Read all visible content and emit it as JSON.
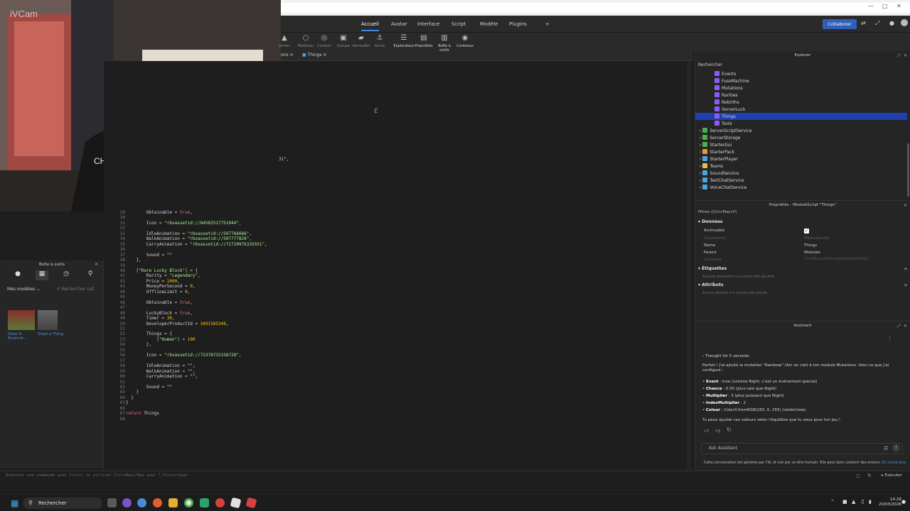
{
  "webcam": {
    "overlay_text": "iVCam",
    "shirt_text": "CHILL·GANG"
  },
  "menu": {
    "tabs": [
      "Accueil",
      "Avatar",
      "Interface",
      "Script",
      "Modèle",
      "Plugins",
      "+"
    ],
    "active": "Accueil",
    "collab_label": "Collaborer"
  },
  "ribbon": {
    "items": [
      {
        "label": "Matériau",
        "icon": "○"
      },
      {
        "label": "Couleur",
        "icon": "◎"
      },
      {
        "label": "Groupe",
        "icon": "▣"
      },
      {
        "label": "Verrouiller",
        "icon": "▰"
      },
      {
        "label": "Ancre",
        "icon": "⚓"
      },
      {
        "label": "Explorateur",
        "icon": "☰"
      },
      {
        "label": "Propriétés",
        "icon": "▤"
      },
      {
        "label": "Boîte à outils",
        "icon": "▥"
      },
      {
        "label": "Contenus",
        "icon": "◉"
      }
    ],
    "partial_label": "porter"
  },
  "tabs": {
    "first": "ons",
    "second": "Things"
  },
  "code": {
    "line_numbers": [
      "29",
      "30",
      "31",
      "32",
      "33",
      "34",
      "35",
      "36",
      "37",
      "38",
      "39",
      "40",
      "41",
      "42",
      "43",
      "44",
      "45",
      "46",
      "47",
      "48",
      "49",
      "50",
      "51",
      "52",
      "53",
      "54",
      "55",
      "56",
      "57",
      "58",
      "59",
      "60",
      "61",
      "62",
      "63",
      "64",
      "65",
      "66",
      "67",
      "68"
    ],
    "fragment": "31\","
  },
  "toolbox": {
    "title": "Boîte à outils",
    "dropdown": "Mes modèles",
    "search_placeholder": "Rechercher (utl",
    "models": [
      {
        "name": "Steal A Brainrot..."
      },
      {
        "name": "Steal a Thing"
      }
    ]
  },
  "command_bar": {
    "placeholder": "Exécuter une commande avec Ctrl+) ou utiliser Ctrl+Haut/Bas pour l'historique",
    "run_label": "Exécuter"
  },
  "explorer": {
    "title": "Explorer",
    "search_placeholder": "Rechercher",
    "items": [
      {
        "name": "Events",
        "indent": 2,
        "color": "#8a5cf6"
      },
      {
        "name": "FuseMachine",
        "indent": 2,
        "color": "#8a5cf6"
      },
      {
        "name": "Mutations",
        "indent": 2,
        "color": "#8a5cf6"
      },
      {
        "name": "Rarities",
        "indent": 2,
        "color": "#8a5cf6"
      },
      {
        "name": "Rebirths",
        "indent": 2,
        "color": "#8a5cf6"
      },
      {
        "name": "ServerLuck",
        "indent": 2,
        "color": "#8a5cf6"
      },
      {
        "name": "Things",
        "indent": 2,
        "color": "#8a5cf6",
        "selected": true
      },
      {
        "name": "Tools",
        "indent": 2,
        "color": "#8a5cf6"
      },
      {
        "name": "ServerScriptService",
        "indent": 0,
        "color": "#4caf50"
      },
      {
        "name": "ServerStorage",
        "indent": 0,
        "color": "#4caf50"
      },
      {
        "name": "StarterGui",
        "indent": 0,
        "color": "#4caf50"
      },
      {
        "name": "StarterPack",
        "indent": 0,
        "color": "#e39b38"
      },
      {
        "name": "StarterPlayer",
        "indent": 0,
        "color": "#4fa3e0"
      },
      {
        "name": "Teams",
        "indent": 0,
        "color": "#e0c04f"
      },
      {
        "name": "SoundService",
        "indent": 0,
        "color": "#4fa3e0"
      },
      {
        "name": "TextChatService",
        "indent": 0,
        "color": "#4fa3e0"
      },
      {
        "name": "VoiceChatService",
        "indent": 0,
        "color": "#4fa3e0"
      }
    ]
  },
  "properties": {
    "title": "Propriétés - ModuleScript \"Things\"",
    "filter_placeholder": "Filtres (Ctrl+Maj+P)",
    "sections": {
      "data": "Données",
      "tags": "Étiquettes",
      "attributes": "Attributs"
    },
    "rows": [
      {
        "label": "Archivable",
        "value": ""
      },
      {
        "label": "ClassName",
        "value": "ModuleScript"
      },
      {
        "label": "Name",
        "value": "Things"
      },
      {
        "label": "Parent",
        "value": "Modules"
      },
      {
        "label": "UniqueId",
        "value": "57a7d6cb3c6f1f1c0e89ba3a89f000001f"
      }
    ],
    "no_tags": "Aucune étiquette n'a encore été ajoutée",
    "no_attributes": "Aucun attribut n'a encore été ajouté"
  },
  "assistant": {
    "title": "Assistant",
    "thought": "Thought for 5 seconds",
    "intro": "Parfait ! J'ai ajouté la mutation \"Rainbow\" (Arc en ciel) à ton module Mutations. Voici ce que j'ai configuré :",
    "bullets": [
      {
        "key": "Event",
        "text": " : true (comme Night, c'est un événement spécial)"
      },
      {
        "key": "Chance",
        "text": " : 0.05 (plus rare que Night)"
      },
      {
        "key": "Multiplier",
        "text": " : 3 (plus puissant que Night)"
      },
      {
        "key": "IndexMultiplier",
        "text": " : 2"
      },
      {
        "key": "Colour",
        "text": " : Color3.fromRGB(255, 0, 255) (violet/rose)"
      }
    ],
    "outro": "Tu peux ajuster ces valeurs selon l'équilibre que tu veux pour ton jeu !",
    "input_placeholder": "Ask Assistant",
    "disclaimer": "Cette conversation est générée par l'IA, et non par un être humain. Elle peut donc contenir des erreurs.",
    "disclaimer_link": "En savoir plus"
  },
  "taskbar": {
    "search_label": "Rechercher",
    "time": "14:29",
    "date": "20/03/2026"
  }
}
